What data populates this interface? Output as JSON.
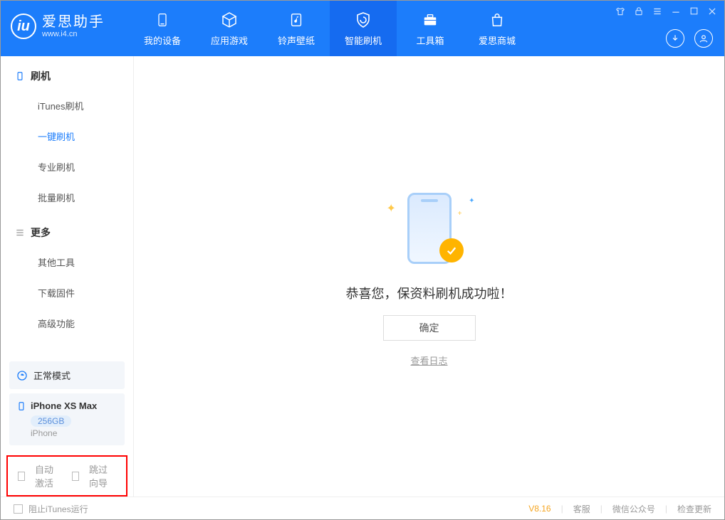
{
  "app": {
    "name": "爱思助手",
    "domain": "www.i4.cn"
  },
  "nav": {
    "device": "我的设备",
    "apps": "应用游戏",
    "wallpaper": "铃声壁纸",
    "flash": "智能刷机",
    "toolbox": "工具箱",
    "store": "爱思商城"
  },
  "sidebar": {
    "flash_head": "刷机",
    "itunes": "iTunes刷机",
    "onekey": "一键刷机",
    "pro": "专业刷机",
    "batch": "批量刷机",
    "more_head": "更多",
    "other": "其他工具",
    "firmware": "下载固件",
    "advanced": "高级功能",
    "mode": "正常模式",
    "device_name": "iPhone XS Max",
    "storage": "256GB",
    "device_type": "iPhone",
    "cb_activate": "自动激活",
    "cb_skip": "跳过向导"
  },
  "main": {
    "message": "恭喜您，保资料刷机成功啦！",
    "confirm": "确定",
    "viewlog": "查看日志"
  },
  "footer": {
    "block_itunes": "阻止iTunes运行",
    "version": "V8.16",
    "support": "客服",
    "wechat": "微信公众号",
    "update": "检查更新"
  }
}
